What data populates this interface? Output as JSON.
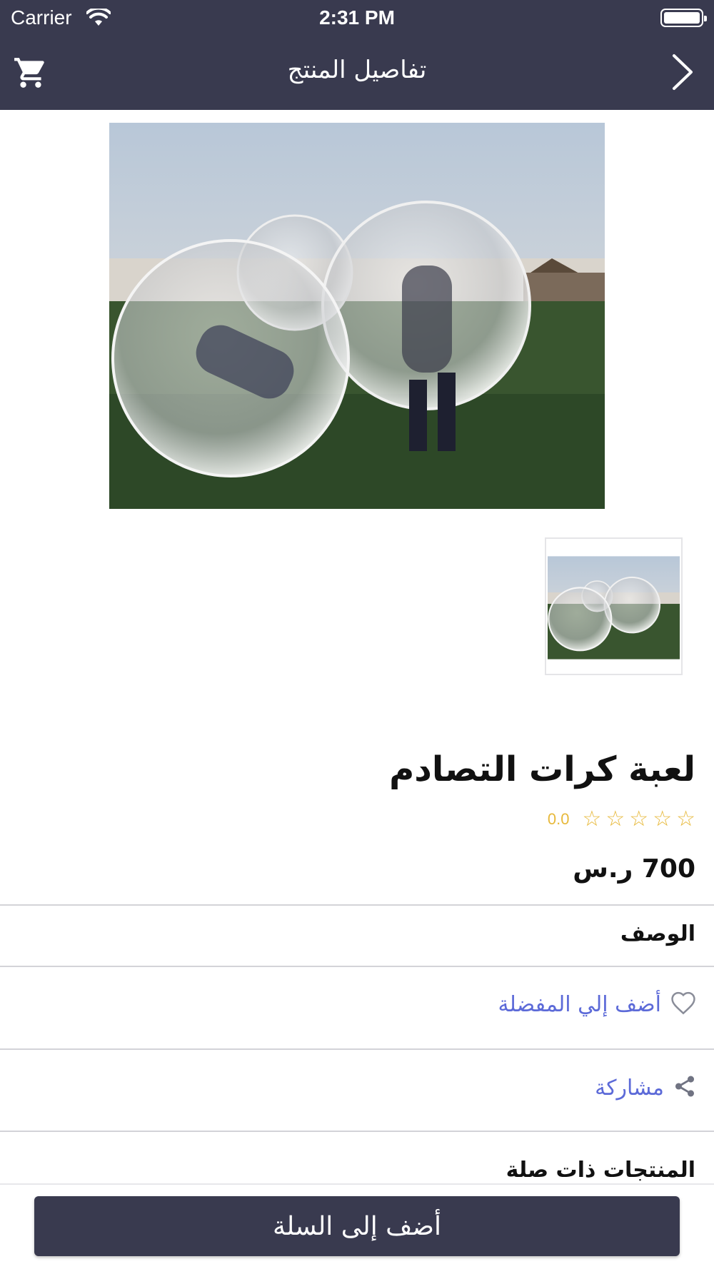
{
  "status_bar": {
    "carrier": "Carrier",
    "time": "2:31 PM"
  },
  "nav": {
    "title": "تفاصيل المنتج",
    "left_icon": "cart-icon",
    "right_icon": "chevron-right-icon"
  },
  "product": {
    "name": "لعبة كرات التصادم",
    "rating": "0.0",
    "stars_filled": 0,
    "stars_total": 5,
    "price": "700 ر.س"
  },
  "sections": {
    "description": "الوصف",
    "favorite": "أضف إلي المفضلة",
    "share": "مشاركة",
    "related": "المنتجات ذات صلة"
  },
  "actions": {
    "add_to_cart": "أضف إلى السلة"
  },
  "colors": {
    "nav_bg": "#393a4f",
    "accent_link": "#5c6ad8",
    "star": "#e7b93b"
  }
}
